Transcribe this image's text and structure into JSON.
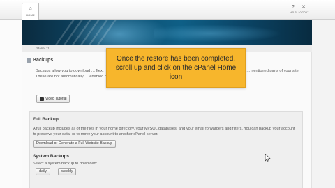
{
  "header": {
    "home_label": "HOME",
    "help_label": "HELP",
    "logout_label": "LOGOUT"
  },
  "breadcrumb": "cPanel 11",
  "page": {
    "title": "Backups",
    "intro": "Backups allow you to download … [text hidden behind callout] … your home directory, databases, email forwarders con… …mentioned parts of your site. These are not automatically … enabled by the server owner/administrator.",
    "tutorial_button": "Video Tutorial"
  },
  "full_backup": {
    "title": "Full Backup",
    "description": "A full backup includes all of the files in your home directory, your MySQL databases, and your email forwarders and filters. You can backup your account to preserve your data, or to move your account to another cPanel server.",
    "generate_button": "Download or Generate a Full Website Backup"
  },
  "system_backups": {
    "title": "System Backups",
    "label": "Select a system backup to download:",
    "daily_button": "daily",
    "weekly_button": "weekly"
  },
  "callout": {
    "text": "Once the restore has been completed, scroll up and click on the cPanel Home icon"
  },
  "colors": {
    "callout_bg": "#f7b62c",
    "banner": "#0e5f86"
  },
  "icons": {
    "home": "home-icon",
    "help": "help-icon",
    "logout": "logout-icon",
    "video": "camera-icon",
    "page": "backup-icon",
    "cursor": "mouse-cursor-icon"
  }
}
